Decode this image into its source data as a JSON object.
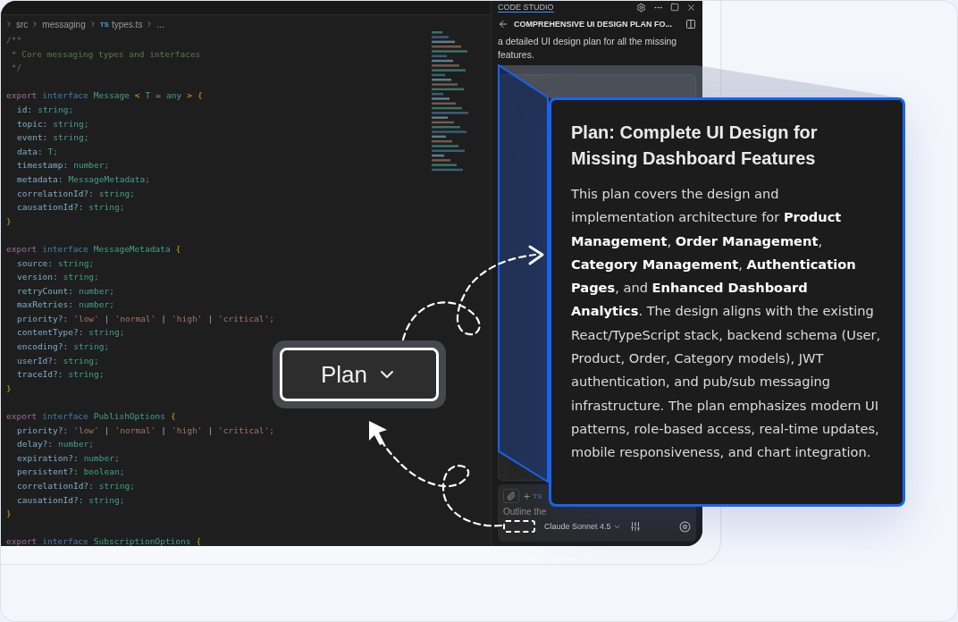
{
  "editor": {
    "breadcrumb": [
      "src",
      "messaging",
      "types.ts",
      "..."
    ],
    "breadcrumb_badge": "TS",
    "lines": [
      {
        "tokens": [
          {
            "kind": "comment",
            "text": "/**"
          }
        ]
      },
      {
        "tokens": [
          {
            "kind": "comment",
            "text": " * Core messaging types and interfaces"
          }
        ]
      },
      {
        "tokens": [
          {
            "kind": "comment",
            "text": " */"
          }
        ]
      },
      {
        "gap": true,
        "tokens": [
          {
            "kind": "kw",
            "text": "export"
          },
          {
            "kind": "decl",
            "text": "interface"
          },
          {
            "kind": "type",
            "text": "Message"
          },
          {
            "kind": "brace",
            "text": "<"
          },
          {
            "kind": "type",
            "text": "T"
          },
          {
            "kind": "punct",
            "text": "="
          },
          {
            "kind": "type",
            "text": "any"
          },
          {
            "kind": "brace",
            "text": ">"
          },
          {
            "kind": "brace",
            "text": "{"
          }
        ]
      },
      {
        "tokens": [
          {
            "kind": "prop",
            "text": "id:"
          },
          {
            "kind": "type",
            "text": "string;"
          }
        ]
      },
      {
        "tokens": [
          {
            "kind": "prop",
            "text": "topic:"
          },
          {
            "kind": "type",
            "text": "string;"
          }
        ]
      },
      {
        "tokens": [
          {
            "kind": "prop",
            "text": "event:"
          },
          {
            "kind": "type",
            "text": "string;"
          }
        ]
      },
      {
        "tokens": [
          {
            "kind": "prop",
            "text": "data:"
          },
          {
            "kind": "type",
            "text": "T;"
          }
        ]
      },
      {
        "tokens": [
          {
            "kind": "prop",
            "text": "timestamp:"
          },
          {
            "kind": "type",
            "text": "number;"
          }
        ]
      },
      {
        "tokens": [
          {
            "kind": "prop",
            "text": "metadata:"
          },
          {
            "kind": "type",
            "text": "MessageMetadata;"
          }
        ]
      },
      {
        "tokens": [
          {
            "kind": "prop",
            "text": "correlationId?:"
          },
          {
            "kind": "type",
            "text": "string;"
          }
        ]
      },
      {
        "tokens": [
          {
            "kind": "prop",
            "text": "causationId?:"
          },
          {
            "kind": "type",
            "text": "string;"
          }
        ]
      },
      {
        "tokens": [
          {
            "kind": "brace",
            "text": "}"
          }
        ]
      },
      {
        "gap": true,
        "tokens": [
          {
            "kind": "kw",
            "text": "export"
          },
          {
            "kind": "decl",
            "text": "interface"
          },
          {
            "kind": "type",
            "text": "MessageMetadata"
          },
          {
            "kind": "brace",
            "text": "{"
          }
        ]
      },
      {
        "tokens": [
          {
            "kind": "prop",
            "text": "source:"
          },
          {
            "kind": "type",
            "text": "string;"
          }
        ]
      },
      {
        "tokens": [
          {
            "kind": "prop",
            "text": "version:"
          },
          {
            "kind": "type",
            "text": "string;"
          }
        ]
      },
      {
        "tokens": [
          {
            "kind": "prop",
            "text": "retryCount:"
          },
          {
            "kind": "type",
            "text": "number;"
          }
        ]
      },
      {
        "tokens": [
          {
            "kind": "prop",
            "text": "maxRetries:"
          },
          {
            "kind": "type",
            "text": "number;"
          }
        ]
      },
      {
        "tokens": [
          {
            "kind": "prop",
            "text": "priority?:"
          },
          {
            "kind": "str",
            "text": "'low'"
          },
          {
            "kind": "punct",
            "text": "|"
          },
          {
            "kind": "str",
            "text": "'normal'"
          },
          {
            "kind": "punct",
            "text": "|"
          },
          {
            "kind": "str",
            "text": "'high'"
          },
          {
            "kind": "punct",
            "text": "|"
          },
          {
            "kind": "str",
            "text": "'critical';"
          }
        ]
      },
      {
        "tokens": [
          {
            "kind": "prop",
            "text": "contentType?:"
          },
          {
            "kind": "type",
            "text": "string;"
          }
        ]
      },
      {
        "tokens": [
          {
            "kind": "prop",
            "text": "encoding?:"
          },
          {
            "kind": "type",
            "text": "string;"
          }
        ]
      },
      {
        "tokens": [
          {
            "kind": "prop",
            "text": "userId?:"
          },
          {
            "kind": "type",
            "text": "string;"
          }
        ]
      },
      {
        "tokens": [
          {
            "kind": "prop",
            "text": "traceId?:"
          },
          {
            "kind": "type",
            "text": "string;"
          }
        ]
      },
      {
        "tokens": [
          {
            "kind": "brace",
            "text": "}"
          }
        ]
      },
      {
        "gap": true,
        "tokens": [
          {
            "kind": "kw",
            "text": "export"
          },
          {
            "kind": "decl",
            "text": "interface"
          },
          {
            "kind": "type",
            "text": "PublishOptions"
          },
          {
            "kind": "brace",
            "text": "{"
          }
        ]
      },
      {
        "tokens": [
          {
            "kind": "prop",
            "text": "priority?:"
          },
          {
            "kind": "str",
            "text": "'low'"
          },
          {
            "kind": "punct",
            "text": "|"
          },
          {
            "kind": "str",
            "text": "'normal'"
          },
          {
            "kind": "punct",
            "text": "|"
          },
          {
            "kind": "str",
            "text": "'high'"
          },
          {
            "kind": "punct",
            "text": "|"
          },
          {
            "kind": "str",
            "text": "'critical';"
          }
        ]
      },
      {
        "tokens": [
          {
            "kind": "prop",
            "text": "delay?:"
          },
          {
            "kind": "type",
            "text": "number;"
          }
        ]
      },
      {
        "tokens": [
          {
            "kind": "prop",
            "text": "expiration?:"
          },
          {
            "kind": "type",
            "text": "number;"
          }
        ]
      },
      {
        "tokens": [
          {
            "kind": "prop",
            "text": "persistent?:"
          },
          {
            "kind": "type",
            "text": "boolean;"
          }
        ]
      },
      {
        "tokens": [
          {
            "kind": "prop",
            "text": "correlationId?:"
          },
          {
            "kind": "type",
            "text": "string;"
          }
        ]
      },
      {
        "tokens": [
          {
            "kind": "prop",
            "text": "causationId?:"
          },
          {
            "kind": "type",
            "text": "string;"
          }
        ]
      },
      {
        "tokens": [
          {
            "kind": "brace",
            "text": "}"
          }
        ]
      },
      {
        "gap": true,
        "tokens": [
          {
            "kind": "kw",
            "text": "export"
          },
          {
            "kind": "decl",
            "text": "interface"
          },
          {
            "kind": "type",
            "text": "SubscriptionOptions"
          },
          {
            "kind": "brace",
            "text": "{"
          }
        ]
      }
    ]
  },
  "chat_panel": {
    "tab": "CODE STUDIO",
    "title": "COMPREHENSIVE UI DESIGN PLAN FO...",
    "message": [
      "a detailed UI design plan for all the missing",
      "features."
    ],
    "attach_chip": "TS",
    "input_placeholder": "Outline the",
    "model": "Claude Sonnet 4.5"
  },
  "mode_button": {
    "label": "Plan"
  },
  "plan_card": {
    "title": "Plan: Complete UI Design for Missing Dashboard Features",
    "body": "This plan covers the design and implementation architecture for **Product Management**, **Order Management**, **Category Management**, **Authentication Pages**, and **Enhanced Dashboard Analytics**. The design aligns with the existing React/TypeScript stack, backend schema (User, Product, Order, Category models), JWT authentication, and pub/sub messaging infrastructure. The plan emphasizes modern UI patterns, role-based access, real-time updates, mobile responsiveness, and chart integration."
  }
}
